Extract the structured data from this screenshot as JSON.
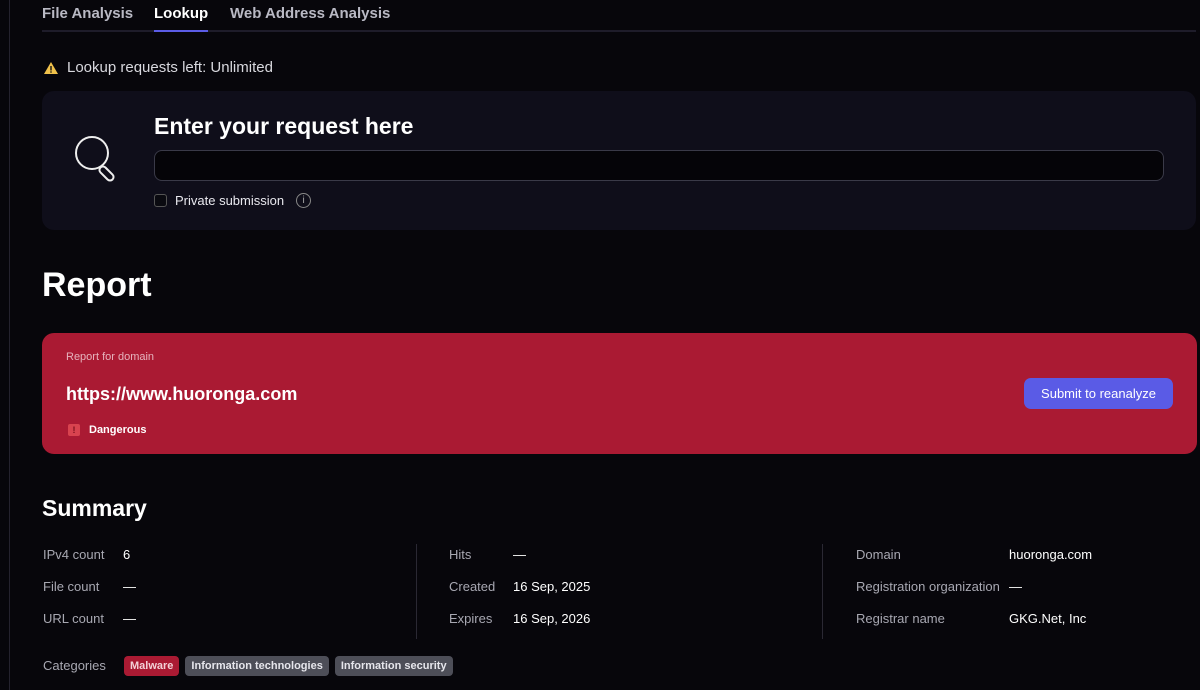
{
  "tabs": [
    "File Analysis",
    "Lookup",
    "Web Address Analysis"
  ],
  "warning": "Lookup requests left: Unlimited",
  "request": {
    "title": "Enter your request here",
    "value": "",
    "private_label": "Private submission"
  },
  "report": {
    "title": "Report",
    "label": "Report for domain",
    "url": "https://www.huoronga.com",
    "status": "Dangerous",
    "button": "Submit to reanalyze",
    "color": "#aa1a33"
  },
  "summary": {
    "title": "Summary",
    "col1": [
      {
        "k": "IPv4 count",
        "v": "6"
      },
      {
        "k": "File count",
        "v": "—"
      },
      {
        "k": "URL count",
        "v": "—"
      }
    ],
    "col2": [
      {
        "k": "Hits",
        "v": "—"
      },
      {
        "k": "Created",
        "v": "16 Sep, 2025"
      },
      {
        "k": "Expires",
        "v": "16 Sep, 2026"
      }
    ],
    "col3": [
      {
        "k": "Domain",
        "v": "huoronga.com"
      },
      {
        "k": "Registration organization",
        "v": "—"
      },
      {
        "k": "Registrar name",
        "v": "GKG.Net, Inc"
      }
    ],
    "categories_label": "Categories",
    "categories": [
      "Malware",
      "Information technologies",
      "Information security"
    ]
  }
}
